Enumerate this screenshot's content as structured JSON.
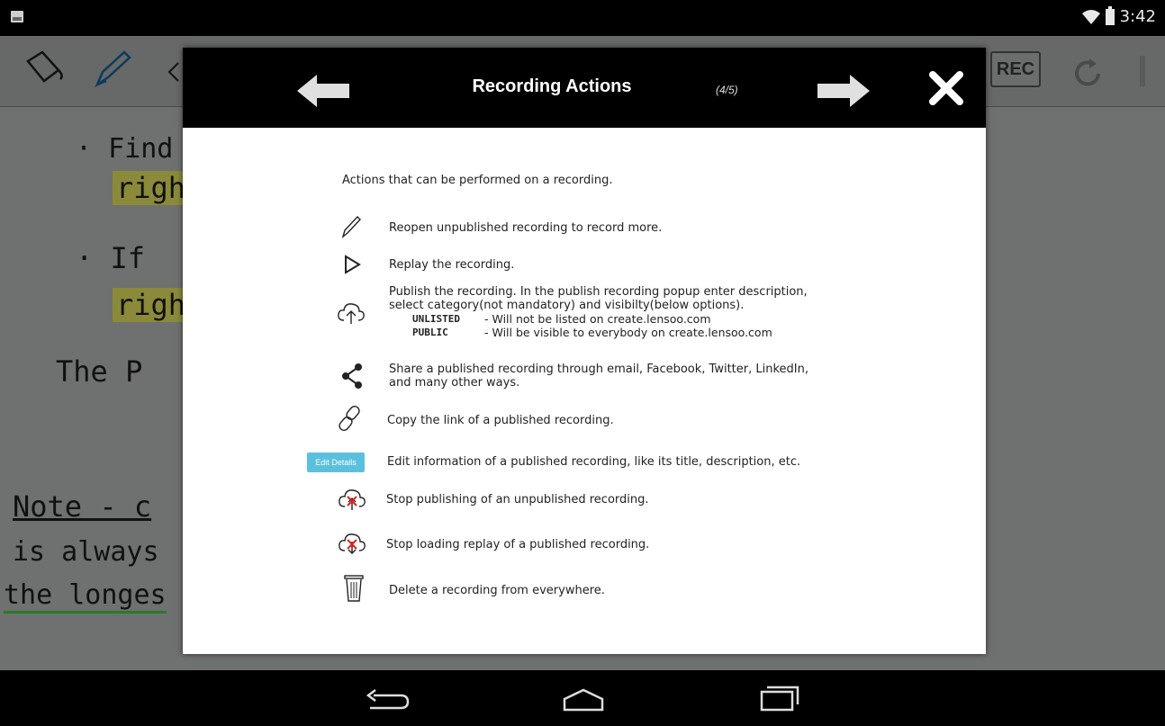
{
  "status_bar": {
    "time": "3:42"
  },
  "toolbar": {
    "rec_label": "REC"
  },
  "canvas": {
    "lines": [
      "· Find",
      "righ",
      "· If",
      "righ",
      "The P",
      "Note - c",
      "is always",
      "the longes"
    ]
  },
  "modal": {
    "title": "Recording Actions",
    "page_indicator": "(4/5)",
    "intro": "Actions that can be performed on a recording.",
    "actions": [
      {
        "icon": "pencil-icon",
        "text": "Reopen unpublished recording to record more."
      },
      {
        "icon": "play-icon",
        "text": "Replay the recording."
      },
      {
        "icon": "cloud-upload-icon",
        "text_line1": "Publish the recording. In the publish recording popup enter description,",
        "text_line2": "select category(not mandatory) and visibilty(below options).",
        "options": [
          {
            "key": "UNLISTED",
            "desc": "- Will not be listed on create.lensoo.com"
          },
          {
            "key": "PUBLIC",
            "desc": "- Will be visible to everybody on create.lensoo.com"
          }
        ]
      },
      {
        "icon": "share-icon",
        "text_line1": "Share a published recording through email, Facebook, Twitter, LinkedIn,",
        "text_line2": "and many other ways."
      },
      {
        "icon": "link-icon",
        "text": "Copy the link of a published recording."
      },
      {
        "icon": "edit-details-button",
        "button_label": "Edit Details",
        "text": "Edit information of a published recording, like its title, description, etc."
      },
      {
        "icon": "cloud-stop-upload-icon",
        "text": "Stop publishing of an unpublished recording."
      },
      {
        "icon": "cloud-stop-download-icon",
        "text": "Stop loading replay of a published recording."
      },
      {
        "icon": "trash-icon",
        "text": "Delete a recording from everywhere."
      }
    ]
  },
  "colors": {
    "header_bg": "#000000",
    "edit_details_bg": "#5bc0de",
    "stop_red": "#e02020"
  }
}
